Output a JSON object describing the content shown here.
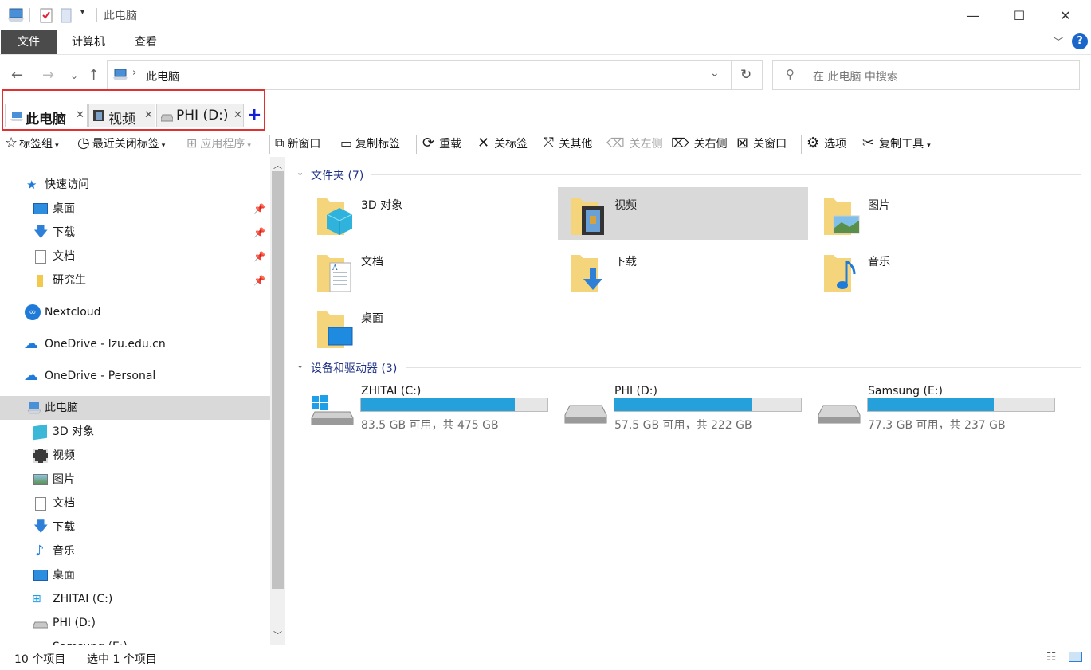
{
  "title_bar": {
    "window_title": "此电脑",
    "minimize": "—",
    "maximize": "☐",
    "close": "✕"
  },
  "ribbon": {
    "tabs": [
      "文件",
      "计算机",
      "查看"
    ],
    "active_tab": "文件",
    "help": "?"
  },
  "address": {
    "path_root": "此电脑",
    "search_placeholder": "在 此电脑 中搜索"
  },
  "folder_tabs": [
    {
      "label": "此电脑",
      "active": true
    },
    {
      "label": "视频",
      "active": false
    },
    {
      "label": "PHI (D:)",
      "active": false
    }
  ],
  "toolbar": {
    "tag_group": "标签组",
    "recent_closed": "最近关闭标签",
    "apps": "应用程序",
    "new_window": "新窗口",
    "copy_tab": "复制标签",
    "reload": "重载",
    "close_tab": "关标签",
    "close_others": "关其他",
    "close_left": "关左侧",
    "close_right": "关右侧",
    "close_window": "关窗口",
    "options": "选项",
    "copy_tools": "复制工具"
  },
  "sidebar": {
    "quick_access": "快速访问",
    "quick_items": [
      "桌面",
      "下载",
      "文档",
      "研究生"
    ],
    "nextcloud": "Nextcloud",
    "onedrive_edu": "OneDrive - lzu.edu.cn",
    "onedrive_personal": "OneDrive - Personal",
    "this_pc": "此电脑",
    "pc_items": [
      "3D 对象",
      "视频",
      "图片",
      "文档",
      "下载",
      "音乐",
      "桌面",
      "ZHITAI (C:)",
      "PHI (D:)",
      "Samsung (E:)"
    ]
  },
  "content": {
    "folders_header": "文件夹 (7)",
    "folders": [
      "3D 对象",
      "视频",
      "图片",
      "文档",
      "下载",
      "音乐",
      "桌面"
    ],
    "selected_folder": "视频",
    "drives_header": "设备和驱动器 (3)",
    "drives": [
      {
        "name": "ZHITAI (C:)",
        "free_text": "83.5 GB 可用，共 475 GB",
        "used_fraction": 0.824
      },
      {
        "name": "PHI (D:)",
        "free_text": "57.5 GB 可用，共 222 GB",
        "used_fraction": 0.741
      },
      {
        "name": "Samsung (E:)",
        "free_text": "77.3 GB 可用，共 237 GB",
        "used_fraction": 0.674
      }
    ]
  },
  "status": {
    "item_count": "10 个项目",
    "selection": "选中 1 个项目"
  },
  "colors": {
    "accent_blue": "#26a0da",
    "ribbon_active": "#4b4b4b",
    "highlight_red": "#e03030",
    "selection_grey": "#d9d9d9"
  }
}
